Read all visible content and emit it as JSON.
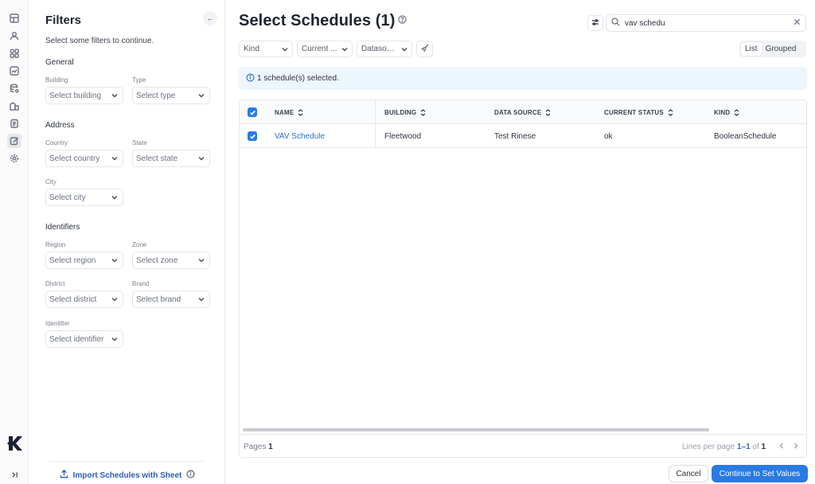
{
  "rail": {
    "icons": [
      "dashboard-icon",
      "users-icon",
      "grid-icon",
      "chart-icon",
      "database-icon",
      "buildings-icon",
      "clipboard-icon",
      "edit-icon",
      "gear-icon"
    ],
    "active": "edit-icon",
    "collapse_glyph": "›|"
  },
  "filters": {
    "title": "Filters",
    "collapse_glyph": "←",
    "hint": "Select some filters to continue.",
    "general": {
      "title": "General",
      "building": {
        "label": "Building",
        "placeholder": "Select building"
      },
      "type": {
        "label": "Type",
        "placeholder": "Select type"
      }
    },
    "address": {
      "title": "Address",
      "country": {
        "label": "Country",
        "placeholder": "Select country"
      },
      "state": {
        "label": "State",
        "placeholder": "Select state"
      },
      "city": {
        "label": "City",
        "placeholder": "Select city"
      }
    },
    "identifiers": {
      "title": "Identifiers",
      "region": {
        "label": "Region",
        "placeholder": "Select region"
      },
      "zone": {
        "label": "Zone",
        "placeholder": "Select zone"
      },
      "district": {
        "label": "District",
        "placeholder": "Select district"
      },
      "brand": {
        "label": "Brand",
        "placeholder": "Select brand"
      },
      "identifier": {
        "label": "Identifier",
        "placeholder": "Select identifier"
      }
    },
    "import_label": "Import Schedules with Sheet"
  },
  "main": {
    "title": "Select Schedules (1)",
    "search": {
      "value": "vav schedu",
      "placeholder": "Search"
    },
    "chips": {
      "kind": "Kind",
      "current": "Current ...",
      "datasource": "Datasour..."
    },
    "view": {
      "list": "List",
      "grouped": "Grouped",
      "selected": "List"
    },
    "banner": "1 schedule(s) selected.",
    "table": {
      "columns": [
        "NAME",
        "BUILDING",
        "DATA SOURCE",
        "CURRENT STATUS",
        "KIND"
      ],
      "rows": [
        {
          "name": "VAV Schedule",
          "building": "Fleetwood",
          "data_source": "Test Rinese",
          "status": "ok",
          "kind": "BooleanSchedule",
          "checked": true
        }
      ]
    },
    "footer": {
      "pages_label": "Pages",
      "pages_value": "1",
      "lines_label": "Lines per page",
      "lines_range": "1–1",
      "lines_of": "of",
      "lines_total": "1"
    },
    "buttons": {
      "cancel": "Cancel",
      "continue": "Continue to Set Values"
    },
    "colors": {
      "accent": "#2a7ae2",
      "banner_bg": "#edf5fd",
      "link": "#2a6fd0"
    }
  }
}
